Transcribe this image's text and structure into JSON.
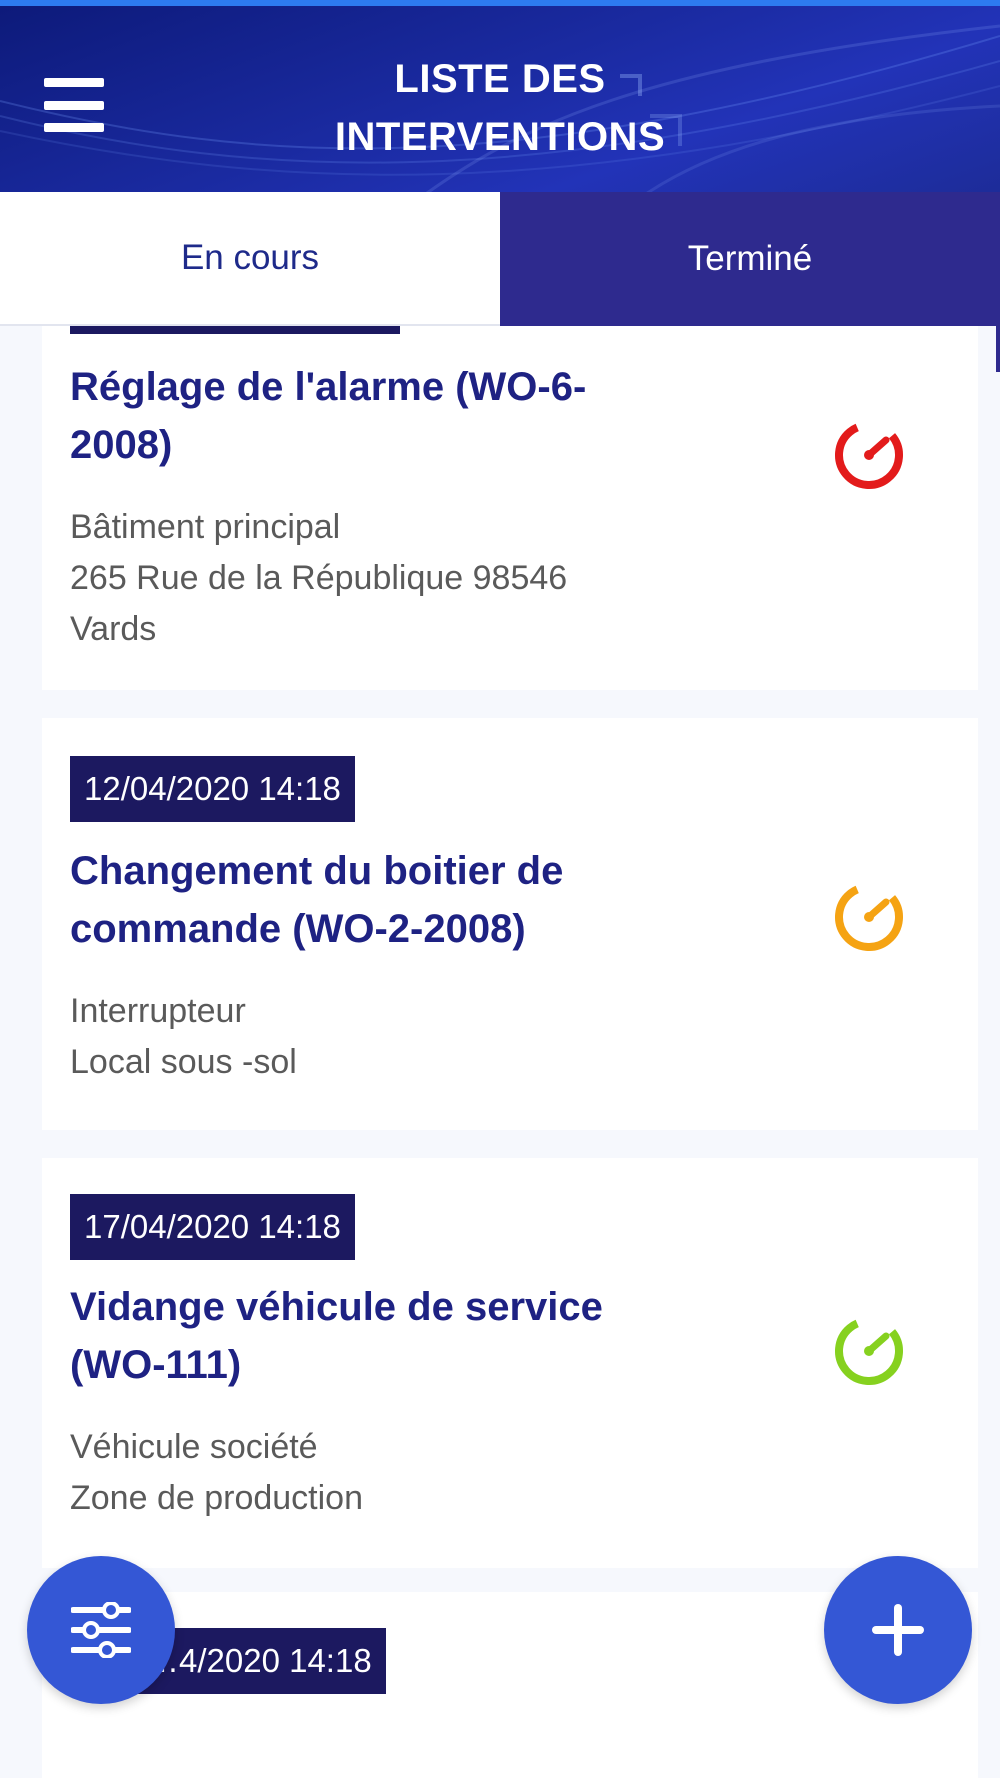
{
  "header": {
    "title_line1": "LISTE DES",
    "title_line2": "INTERVENTIONS",
    "menu_icon": "hamburger-menu-icon"
  },
  "tabs": [
    {
      "label": "En cours",
      "active": true
    },
    {
      "label": "Terminé",
      "active": false
    }
  ],
  "interventions": [
    {
      "date": "",
      "title_line1": "Réglage de l'alarme (WO-6-",
      "title_line2": "2008)",
      "lines": [
        "Bâtiment principal",
        "265 Rue de la République 98546",
        "Vards"
      ],
      "status_icon": "gauge-icon",
      "status_color": "#e31b1b"
    },
    {
      "date": "12/04/2020 14:18",
      "title_line1": "Changement du boitier de",
      "title_line2": "commande (WO-2-2008)",
      "lines": [
        "Interrupteur",
        "Local sous -sol"
      ],
      "status_icon": "gauge-icon",
      "status_color": "#f5a313"
    },
    {
      "date": "17/04/2020 14:18",
      "title_line1": "Vidange véhicule de service",
      "title_line2": "(WO-111)",
      "lines": [
        "Véhicule société",
        "Zone de production"
      ],
      "status_icon": "gauge-icon",
      "status_color": "#86d11f"
    },
    {
      "date": "…4/2020 14:18"
    }
  ],
  "fabs": {
    "filter_icon": "sliders-filter-icon",
    "add_icon": "plus-icon"
  },
  "colors": {
    "header_bg": "#1a2aa0",
    "tab_inactive_bg": "#2e2a8e",
    "title_text": "#1e2283",
    "badge_bg": "#1c1960",
    "fab_bg": "#3457d5"
  }
}
